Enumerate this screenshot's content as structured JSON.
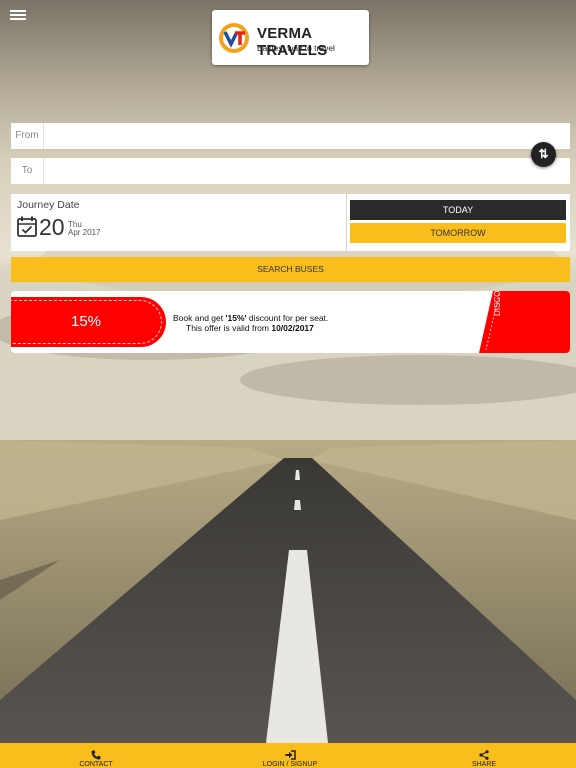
{
  "header": {
    "menu_icon": "hamburger-icon",
    "logo": {
      "mark": "VT",
      "title": "VERMA TRAVELS",
      "tagline": "Easiest way to travel"
    }
  },
  "search": {
    "from": {
      "label": "From",
      "value": ""
    },
    "to": {
      "label": "To",
      "value": ""
    },
    "swap_icon": "swap-vertical-icon",
    "swap_label": "⇅",
    "journey": {
      "title": "Journey Date",
      "day": "20",
      "weekday": "Thu",
      "month_year": "Apr 2017",
      "icon": "calendar-check-icon"
    },
    "today_label": "TODAY",
    "tomorrow_label": "TOMORROW",
    "search_label": "SEARCH BUSES"
  },
  "offer": {
    "percent": "15%",
    "line1_prefix": "Book and get ",
    "line1_bold": "'15%'",
    "line1_suffix": " discount for per seat.",
    "line2_prefix": "This offer is valid from ",
    "line2_bold": "10/02/2017",
    "tag": "DISCOUNT"
  },
  "footer": {
    "items": [
      {
        "label": "CONTACT",
        "icon": "phone-icon"
      },
      {
        "label": "LOGIN / SIGNUP",
        "icon": "sign-in-icon"
      },
      {
        "label": "SHARE",
        "icon": "share-icon"
      }
    ]
  },
  "colors": {
    "accent": "#f9bd1c",
    "dark": "#2a2a2a",
    "offer_red": "#ff0000"
  }
}
